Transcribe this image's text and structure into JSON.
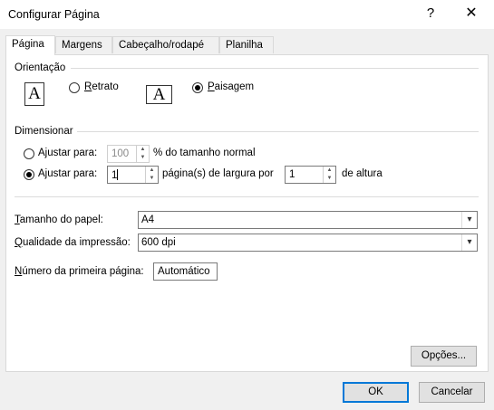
{
  "window": {
    "title": "Configurar Página",
    "help_glyph": "?",
    "close_glyph": "✕"
  },
  "tabs": [
    {
      "label": "Página"
    },
    {
      "label": "Margens"
    },
    {
      "label": "Cabeçalho/rodapé"
    },
    {
      "label": "Planilha"
    }
  ],
  "orientation": {
    "group_label": "Orientação",
    "portrait": {
      "prefix": "",
      "mnemonic": "R",
      "rest": "etrato",
      "selected": false
    },
    "landscape": {
      "prefix": "",
      "mnemonic": "P",
      "rest": "aisagem",
      "selected": true
    },
    "icon_letter": "A"
  },
  "scaling": {
    "group_label": "Dimensionar",
    "adjust_percent": {
      "prefix": "A",
      "mnemonic": "j",
      "rest": "ustar para:",
      "value": "100",
      "suffix": "% do tamanho normal",
      "selected": false
    },
    "fit_to": {
      "prefix": "A",
      "mnemonic": "j",
      "rest": "ustar para:",
      "pages_wide": "1",
      "wide_suffix": "página(s) de largura por",
      "pages_tall": "1",
      "tall_suffix": "de altura",
      "selected": true
    }
  },
  "paper_size": {
    "prefix": "",
    "mnemonic": "T",
    "rest": "amanho do papel:",
    "value": "A4"
  },
  "print_quality": {
    "prefix": "",
    "mnemonic": "Q",
    "rest": "ualidade da impressão:",
    "value": "600 dpi"
  },
  "first_page_number": {
    "prefix": "",
    "mnemonic": "N",
    "rest": "úmero da primeira página:",
    "value": "Automático"
  },
  "buttons": {
    "options": "Opções...",
    "ok": "OK",
    "cancel": "Cancelar"
  }
}
